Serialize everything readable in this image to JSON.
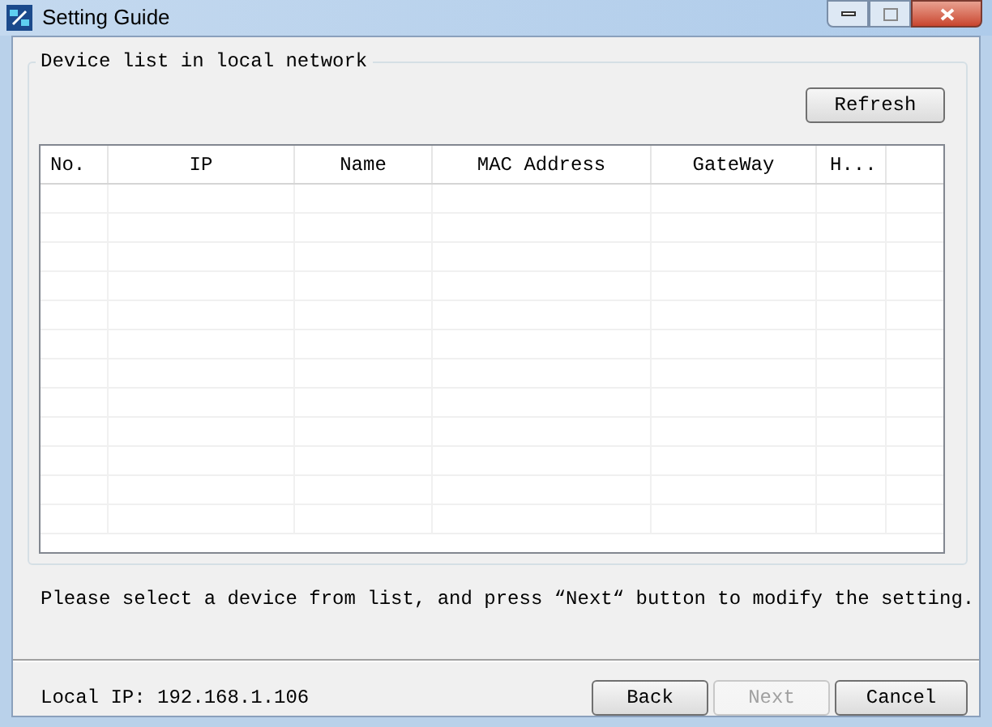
{
  "window": {
    "title": "Setting Guide"
  },
  "group": {
    "title": "Device list in local network"
  },
  "refresh_button": {
    "label": "Refresh",
    "disabled": false
  },
  "table": {
    "columns": [
      "No.",
      "IP",
      "Name",
      "MAC Address",
      "GateWay",
      "H..."
    ]
  },
  "instruction": "Please select a device from list, and press “Next“ button to modify the setting.",
  "local_ip": "Local IP: 192.168.1.106",
  "buttons": [
    {
      "label": "Back",
      "disabled": false
    },
    {
      "label": "Next",
      "disabled": true
    },
    {
      "label": "Cancel",
      "disabled": false
    }
  ]
}
